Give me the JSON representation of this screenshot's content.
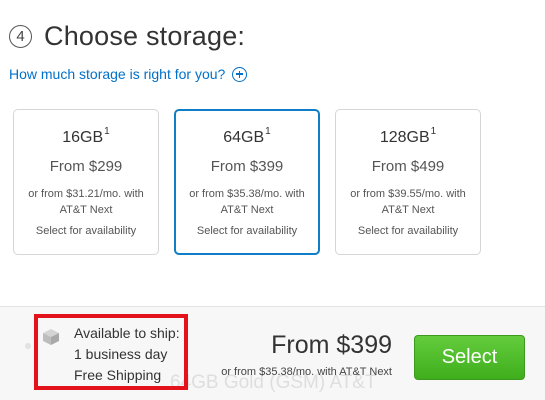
{
  "step": {
    "number": "4",
    "title": "Choose storage:"
  },
  "help_link": {
    "label": "How much storage is right for you?",
    "icon": "plus-circle-icon"
  },
  "options": [
    {
      "capacity": "16GB",
      "footnote": "1",
      "price": "From $299",
      "monthly": "or from $31.21/mo. with AT&T Next",
      "availability": "Select for availability",
      "selected": false
    },
    {
      "capacity": "64GB",
      "footnote": "1",
      "price": "From $399",
      "monthly": "or from $35.38/mo. with AT&T Next",
      "availability": "Select for availability",
      "selected": true
    },
    {
      "capacity": "128GB",
      "footnote": "1",
      "price": "From $499",
      "monthly": "or from $39.55/mo. with AT&T Next",
      "availability": "Select for availability",
      "selected": false
    }
  ],
  "summary": {
    "ship_heading": "Available to ship:",
    "ship_time": "1 business day",
    "shipping": "Free Shipping",
    "price": "From $399",
    "monthly": "or from $35.38/mo. with AT&T Next",
    "ghost_product": "64GB Gold (GSM) AT&T",
    "select_label": "Select",
    "icon": "package-icon"
  },
  "colors": {
    "link": "#0070c9",
    "selected_border": "#0f7ec6",
    "button_green": "#4cbb28",
    "highlight_red": "#e3121b"
  }
}
